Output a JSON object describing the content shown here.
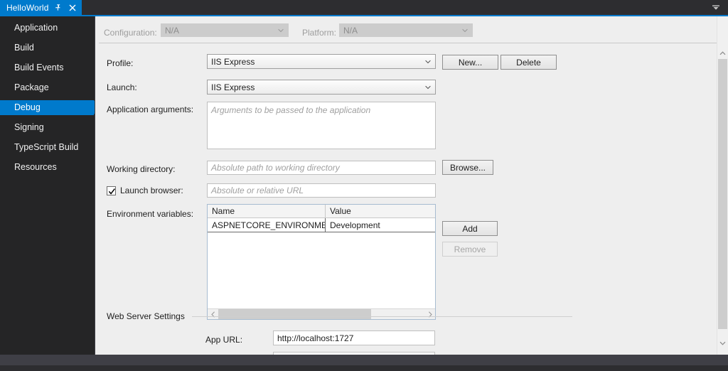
{
  "window": {
    "tab_title": "HelloWorld",
    "pin_icon": "pin-icon",
    "close_icon": "close-icon",
    "overflow_icon": "chevron-down-icon"
  },
  "sidebar": {
    "items": [
      {
        "label": "Application",
        "selected": false
      },
      {
        "label": "Build",
        "selected": false
      },
      {
        "label": "Build Events",
        "selected": false
      },
      {
        "label": "Package",
        "selected": false
      },
      {
        "label": "Debug",
        "selected": true
      },
      {
        "label": "Signing",
        "selected": false
      },
      {
        "label": "TypeScript Build",
        "selected": false
      },
      {
        "label": "Resources",
        "selected": false
      }
    ]
  },
  "toolbar": {
    "configuration_label": "Configuration:",
    "configuration_value": "N/A",
    "platform_label": "Platform:",
    "platform_value": "N/A"
  },
  "form": {
    "profile_label": "Profile:",
    "profile_value": "IIS Express",
    "new_button": "New...",
    "delete_button": "Delete",
    "launch_label": "Launch:",
    "launch_value": "IIS Express",
    "app_args_label": "Application arguments:",
    "app_args_placeholder": "Arguments to be passed to the application",
    "app_args_value": "",
    "working_dir_label": "Working directory:",
    "working_dir_placeholder": "Absolute path to working directory",
    "working_dir_value": "",
    "browse_button": "Browse...",
    "launch_browser_label": "Launch browser:",
    "launch_browser_checked": true,
    "launch_browser_placeholder": "Absolute or relative URL",
    "launch_browser_value": "",
    "env_vars_label": "Environment variables:",
    "env_columns": [
      "Name",
      "Value"
    ],
    "env_rows": [
      {
        "name": "ASPNETCORE_ENVIRONMENT",
        "value": "Development"
      }
    ],
    "add_button": "Add",
    "remove_button": "Remove",
    "remove_disabled": true,
    "web_server_section": "Web Server Settings",
    "app_url_label": "App URL:",
    "app_url_value": "http://localhost:1727"
  },
  "colors": {
    "accent": "#007acc",
    "chrome_dark": "#2d2d30",
    "panel_dark": "#252526",
    "form_bg": "#eeeeee"
  }
}
